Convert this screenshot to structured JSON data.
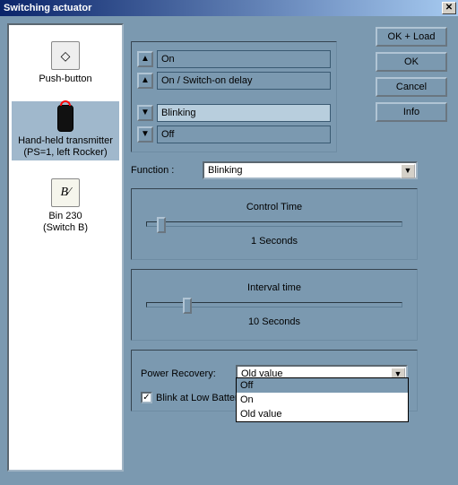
{
  "window": {
    "title": "Switching actuator",
    "close_glyph": "✕"
  },
  "devices": [
    {
      "label": "Push-button",
      "icon": "◇",
      "selected": false,
      "kind": "push"
    },
    {
      "label": "Hand-held transmitter\n(PS=1, left Rocker)",
      "icon": "",
      "selected": true,
      "kind": "remote"
    },
    {
      "label": "Bin 230\n(Switch B)",
      "icon": "B⁄",
      "selected": false,
      "kind": "bin"
    }
  ],
  "buttons": {
    "ok_load": "OK + Load",
    "ok": "OK",
    "cancel": "Cancel",
    "info": "Info"
  },
  "list": {
    "rows": [
      {
        "arrow": "▲",
        "label": "On",
        "selected": false
      },
      {
        "arrow": "▲",
        "label": "On / Switch-on delay",
        "selected": false
      }
    ],
    "rows2": [
      {
        "arrow": "▼",
        "label": "Blinking",
        "selected": true
      },
      {
        "arrow": "▼",
        "label": "Off",
        "selected": false
      }
    ]
  },
  "function": {
    "label": "Function :",
    "value": "Blinking"
  },
  "slider1": {
    "title": "Control Time",
    "value_text": "1 Seconds",
    "pos_pct": 4
  },
  "slider2": {
    "title": "Interval time",
    "value_text": "10 Seconds",
    "pos_pct": 14
  },
  "power_recovery": {
    "label": "Power Recovery:",
    "value": "Old value",
    "options": [
      "Off",
      "On",
      "Old value"
    ],
    "highlighted": "Off"
  },
  "blink_low": {
    "label": "Blink at Low Battery S",
    "checked": true
  }
}
